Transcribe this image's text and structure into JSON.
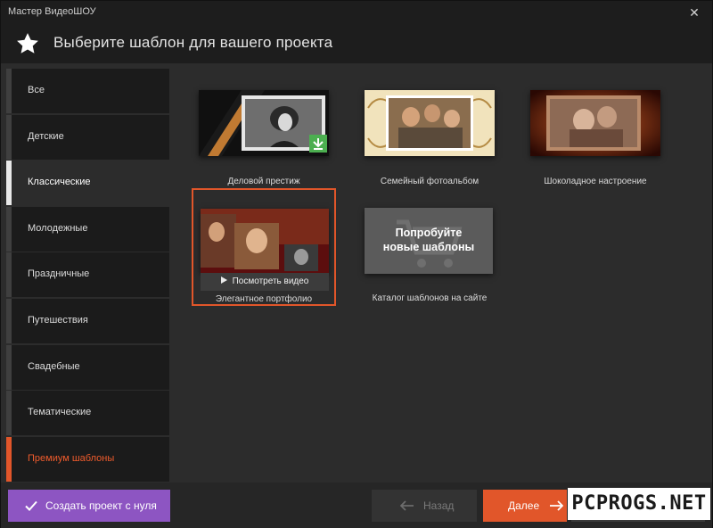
{
  "window": {
    "title": "Мастер ВидеоШОУ",
    "close_glyph": "✕"
  },
  "header": {
    "icon": "star-icon",
    "heading": "Выберите шаблон для вашего проекта"
  },
  "sidebar": {
    "items": [
      {
        "label": "Все"
      },
      {
        "label": "Детские"
      },
      {
        "label": "Классические",
        "active": true
      },
      {
        "label": "Молодежные"
      },
      {
        "label": "Праздничные"
      },
      {
        "label": "Путешествия"
      },
      {
        "label": "Свадебные"
      },
      {
        "label": "Тематические"
      },
      {
        "label": "Премиум шаблоны",
        "highlight": true
      }
    ]
  },
  "templates": [
    {
      "label": "Деловой престиж",
      "badge_icon": "download-icon"
    },
    {
      "label": "Семейный фотоальбом"
    },
    {
      "label": "Шоколадное настроение"
    },
    {
      "label": "Элегантное портфолио",
      "selected": true,
      "overlay_label": "Посмотреть видео"
    },
    {
      "label": "Каталог шаблонов на сайте",
      "cta_text": "Попробуйте\nновые шаблоны"
    }
  ],
  "footer": {
    "create_new_label": "Создать проект с нуля",
    "back_label": "Назад",
    "next_label": "Далее"
  },
  "watermark": "PCPROGS.NET",
  "colors": {
    "accent": "#e1562a",
    "create_button": "#8d55c2",
    "background": "#2c2c2c",
    "sidebar_item": "#1b1b1b"
  }
}
